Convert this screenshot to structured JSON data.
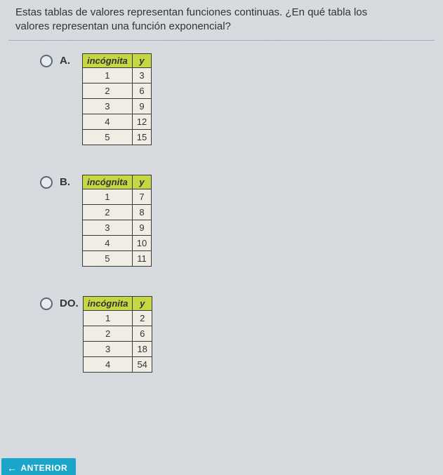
{
  "question_line1": "Estas tablas de valores representan funciones continuas. ¿En qué tabla los",
  "question_line2": "valores representan una función exponencial?",
  "headers": {
    "col1": "incógnita",
    "col2": "y"
  },
  "options": {
    "A": {
      "label": "A."
    },
    "B": {
      "label": "B."
    },
    "DO": {
      "label": "DO."
    }
  },
  "nav": {
    "prev": "ANTERIOR"
  },
  "chart_data": [
    {
      "type": "table",
      "option": "A",
      "columns": [
        "incógnita",
        "y"
      ],
      "rows": [
        [
          1,
          3
        ],
        [
          2,
          6
        ],
        [
          3,
          9
        ],
        [
          4,
          12
        ],
        [
          5,
          15
        ]
      ]
    },
    {
      "type": "table",
      "option": "B",
      "columns": [
        "incógnita",
        "y"
      ],
      "rows": [
        [
          1,
          7
        ],
        [
          2,
          8
        ],
        [
          3,
          9
        ],
        [
          4,
          10
        ],
        [
          5,
          11
        ]
      ]
    },
    {
      "type": "table",
      "option": "DO",
      "columns": [
        "incógnita",
        "y"
      ],
      "rows": [
        [
          1,
          2
        ],
        [
          2,
          6
        ],
        [
          3,
          18
        ],
        [
          4,
          54
        ]
      ]
    }
  ]
}
